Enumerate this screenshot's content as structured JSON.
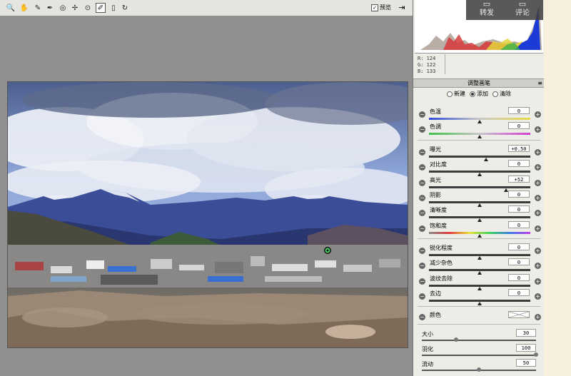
{
  "toolbar": {
    "tools": [
      {
        "name": "zoom-tool",
        "icon": "zoom-icon",
        "glyph": "🔍"
      },
      {
        "name": "hand-tool",
        "icon": "hand-icon",
        "glyph": "✋"
      },
      {
        "name": "white-balance-tool",
        "icon": "eyedropper-icon",
        "glyph": "✎"
      },
      {
        "name": "color-sampler-tool",
        "icon": "color-sampler-icon",
        "glyph": "✒"
      },
      {
        "name": "targeted-adjust-tool",
        "icon": "target-icon",
        "glyph": "◎"
      },
      {
        "name": "spot-removal-tool",
        "icon": "spot-icon",
        "glyph": "✢"
      },
      {
        "name": "red-eye-tool",
        "icon": "red-eye-icon",
        "glyph": "⊙"
      },
      {
        "name": "adjustment-brush-tool",
        "icon": "brush-icon",
        "glyph": "✐"
      },
      {
        "name": "graduated-filter-tool",
        "icon": "gradient-icon",
        "glyph": "▯"
      },
      {
        "name": "rotate-tool",
        "icon": "rotate-icon",
        "glyph": "↻"
      }
    ],
    "preview_label": "预览",
    "preview_checked": true
  },
  "overlay": {
    "share_label": "转发",
    "comment_label": "评论"
  },
  "readout": {
    "r": "R:  124",
    "g": "G:  122",
    "b": "B:  133"
  },
  "panel": {
    "title": "调整画笔",
    "modes": [
      {
        "label": "新建",
        "selected": false
      },
      {
        "label": "添加",
        "selected": true
      },
      {
        "label": "清除",
        "selected": false
      }
    ],
    "group1": [
      {
        "label": "色温",
        "value": "0",
        "pos": 0.5,
        "track": "temp"
      },
      {
        "label": "色调",
        "value": "0",
        "pos": 0.5,
        "track": "tint"
      }
    ],
    "group2": [
      {
        "label": "曝光",
        "value": "+0.50",
        "pos": 0.56,
        "track": "dark"
      },
      {
        "label": "对比度",
        "value": "0",
        "pos": 0.5,
        "track": "dark"
      },
      {
        "label": "高光",
        "value": "+52",
        "pos": 0.76,
        "track": "dark"
      },
      {
        "label": "阴影",
        "value": "0",
        "pos": 0.5,
        "track": "dark"
      },
      {
        "label": "清晰度",
        "value": "0",
        "pos": 0.5,
        "track": "dark"
      },
      {
        "label": "饱和度",
        "value": "0",
        "pos": 0.5,
        "track": "sat"
      }
    ],
    "group3": [
      {
        "label": "锐化程度",
        "value": "0",
        "pos": 0.5,
        "track": "dark"
      },
      {
        "label": "减少杂色",
        "value": "0",
        "pos": 0.5,
        "track": "dark"
      },
      {
        "label": "波纹去除",
        "value": "0",
        "pos": 0.5,
        "track": "dark"
      },
      {
        "label": "去边",
        "value": "0",
        "pos": 0.5,
        "track": "dark"
      }
    ],
    "color_label": "颜色",
    "brush": [
      {
        "label": "大小",
        "value": "30",
        "pos": 0.3
      },
      {
        "label": "羽化",
        "value": "100",
        "pos": 1.0
      },
      {
        "label": "流动",
        "value": "50",
        "pos": 0.5
      }
    ]
  },
  "colors": {
    "panel_bg": "#eeece6",
    "canvas_bg": "#8f8f8f",
    "sky": "#6d89c4",
    "mountain": "#31448c"
  }
}
